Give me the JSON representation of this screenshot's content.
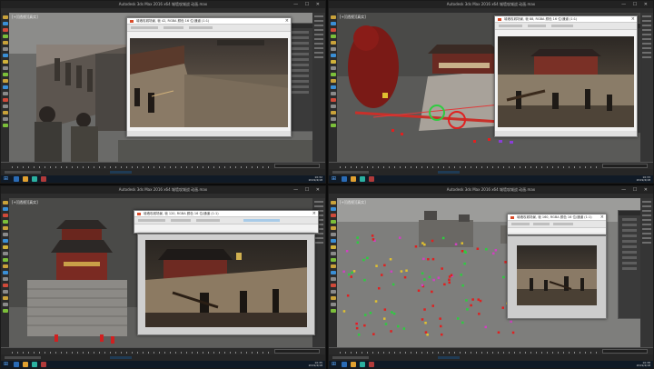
{
  "quadrants": [
    {
      "window_title": "Autodesk 3ds Max 2016 x64    城墙攻城战 动画.max",
      "viewport_label": "[+][透视][真实]",
      "render_title": "城墙攻城场景, 帧 42, RGBA 颜色 16 位/通道 (1:1)",
      "clock": "10:32\n2019/4/18"
    },
    {
      "window_title": "Autodesk 3ds Max 2016 x64    城墙攻城战 动画.max",
      "viewport_label": "[+][透视][真实]",
      "render_title": "城墙攻城场景, 帧 88, RGBA 颜色 16 位/通道 (1:1)",
      "clock": "10:33\n2019/4/18"
    },
    {
      "window_title": "Autodesk 3ds Max 2016 x64    城墙攻城战 动画.max",
      "viewport_label": "[+][透视][真实]",
      "render_title": "城墙攻城场景, 帧 120, RGBA 颜色 16 位/通道 (1:1)",
      "clock": "10:35\n2019/4/18"
    },
    {
      "window_title": "Autodesk 3ds Max 2016 x64    城墙攻城战 动画.max",
      "viewport_label": "[+][透视][真实]",
      "render_title": "城墙攻城场景, 帧 160, RGBA 颜色 16 位/通道 (1:1)",
      "clock": "10:38\n2019/4/18"
    }
  ],
  "window_buttons": "— ☐ ✕",
  "start_icon": "windows-logo-icon",
  "colors": {
    "ui_dark": "#3c3c3c",
    "taskbar": "#101a26",
    "accent_blue": "#5aa9ff",
    "selection_green": "#2ecc40",
    "selection_red": "#e02020"
  }
}
